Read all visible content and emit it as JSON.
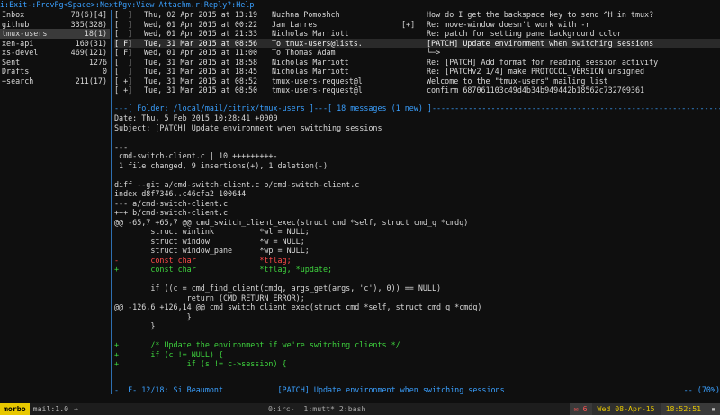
{
  "helpbar": [
    "i:Exit",
    "-:PrevPg",
    "<Space>:NextPg",
    "v:View Attachm.",
    "r:Reply",
    "?:Help"
  ],
  "sidebar": [
    {
      "name": "Inbox",
      "count": "78(6)[4]"
    },
    {
      "name": "github",
      "count": "335(328)"
    },
    {
      "name": "tmux-users",
      "count": "18(1)"
    },
    {
      "name": "xen-api",
      "count": "160(31)"
    },
    {
      "name": "xs-devel",
      "count": "469(121)"
    },
    {
      "name": "Sent",
      "count": "1276"
    },
    {
      "name": "Drafts",
      "count": "0"
    },
    {
      "name": "+search",
      "count": "211(17)"
    }
  ],
  "index": [
    {
      "flag": "[  ]",
      "date": "Thu, 02 Apr 2015 at 13:19",
      "from": "Nuzhna Pomoshch",
      "tag": "",
      "subject": "How do I get the backspace key to send ^H in tmux?"
    },
    {
      "flag": "[  ]",
      "date": "Wed, 01 Apr 2015 at 00:22",
      "from": "Jan Larres",
      "tag": "[+]",
      "subject": "Re: move-window doesn't work with -r"
    },
    {
      "flag": "[  ]",
      "date": "Wed, 01 Apr 2015 at 21:33",
      "from": "Nicholas Marriott",
      "tag": "",
      "subject": "Re: patch for setting pane background color"
    },
    {
      "flag": "[ F]",
      "date": "Tue, 31 Mar 2015 at 08:56",
      "from": "To tmux-users@lists.",
      "tag": "",
      "subject": "[PATCH] Update environment when switching sessions"
    },
    {
      "flag": "[ F]",
      "date": "Wed, 01 Apr 2015 at 11:00",
      "from": "To Thomas Adam",
      "tag": "",
      "subject": "└─>"
    },
    {
      "flag": "[  ]",
      "date": "Tue, 31 Mar 2015 at 18:58",
      "from": "Nicholas Marriott",
      "tag": "",
      "subject": "Re: [PATCH] Add format for reading session activity"
    },
    {
      "flag": "[  ]",
      "date": "Tue, 31 Mar 2015 at 18:45",
      "from": "Nicholas Marriott",
      "tag": "",
      "subject": "Re: [PATCHv2 1/4] make PROTOCOL_VERSION unsigned"
    },
    {
      "flag": "[ +]",
      "date": "Tue, 31 Mar 2015 at 08:52",
      "from": "tmux-users-request@l",
      "tag": "",
      "subject": "Welcome to the \"tmux-users\" mailing list"
    },
    {
      "flag": "[ +]",
      "date": "Tue, 31 Mar 2015 at 08:50",
      "from": "tmux-users-request@l",
      "tag": "",
      "subject": "confirm 687061103c49d4b34b949442b18562c732709361"
    }
  ],
  "folderbar": "---[ Folder: /local/mail/citrix/tmux-users ]---[ 18 messages (1 new) ]--------------------------------------------------------------------",
  "pager": [
    {
      "cls": "hdr",
      "text": "Date: Thu, 5 Feb 2015 10:28:41 +0000"
    },
    {
      "cls": "hdr",
      "text": "Subject: [PATCH] Update environment when switching sessions"
    },
    {
      "cls": "diff-ctx",
      "text": ""
    },
    {
      "cls": "diff-ctx",
      "text": "---"
    },
    {
      "cls": "diff-ctx",
      "text": " cmd-switch-client.c | 10 +++++++++-"
    },
    {
      "cls": "diff-ctx",
      "text": " 1 file changed, 9 insertions(+), 1 deletion(-)"
    },
    {
      "cls": "diff-ctx",
      "text": ""
    },
    {
      "cls": "diff-ctx",
      "text": "diff --git a/cmd-switch-client.c b/cmd-switch-client.c"
    },
    {
      "cls": "diff-ctx",
      "text": "index d8f7346..c46cfa2 100644"
    },
    {
      "cls": "diff-ctx",
      "text": "--- a/cmd-switch-client.c"
    },
    {
      "cls": "diff-ctx",
      "text": "+++ b/cmd-switch-client.c"
    },
    {
      "cls": "diff-hunk",
      "text": "@@ -65,7 +65,7 @@ cmd_switch_client_exec(struct cmd *self, struct cmd_q *cmdq)"
    },
    {
      "cls": "diff-ctx",
      "text": "        struct winlink          *wl = NULL;"
    },
    {
      "cls": "diff-ctx",
      "text": "        struct window           *w = NULL;"
    },
    {
      "cls": "diff-ctx",
      "text": "        struct window_pane      *wp = NULL;"
    },
    {
      "cls": "diff-del",
      "text": "-       const char              *tflag;"
    },
    {
      "cls": "diff-add",
      "text": "+       const char              *tflag, *update;"
    },
    {
      "cls": "diff-ctx",
      "text": ""
    },
    {
      "cls": "diff-ctx",
      "text": "        if ((c = cmd_find_client(cmdq, args_get(args, 'c'), 0)) == NULL)"
    },
    {
      "cls": "diff-ctx",
      "text": "                return (CMD_RETURN_ERROR);"
    },
    {
      "cls": "diff-hunk",
      "text": "@@ -126,6 +126,14 @@ cmd_switch_client_exec(struct cmd *self, struct cmd_q *cmdq)"
    },
    {
      "cls": "diff-ctx",
      "text": "                }"
    },
    {
      "cls": "diff-ctx",
      "text": "        }"
    },
    {
      "cls": "diff-ctx",
      "text": ""
    },
    {
      "cls": "diff-add",
      "text": "+       /* Update the environment if we're switching clients */"
    },
    {
      "cls": "diff-add",
      "text": "+       if (c != NULL) {"
    },
    {
      "cls": "diff-add",
      "text": "+               if (s != c->session) {"
    }
  ],
  "pagerstatus": {
    "left": "-  F- 12/18: Si Beaumont            [PATCH] Update environment when switching sessions",
    "right": "-- (70%)"
  },
  "tmux": {
    "session": "morbo",
    "tab": "mail:1.0",
    "arrow": "→",
    "windows": "0:irc-  1:mutt* 2:bash",
    "mailcount": "✉ 6",
    "date": "Wed 08-Apr-15",
    "time": "18:52:51",
    "host": "▪"
  },
  "colors": {
    "accent_blue": "#3aa0ff",
    "diff_add": "#3ed33e",
    "diff_del": "#ff4a4a",
    "tmux_yellow": "#e8c800"
  }
}
